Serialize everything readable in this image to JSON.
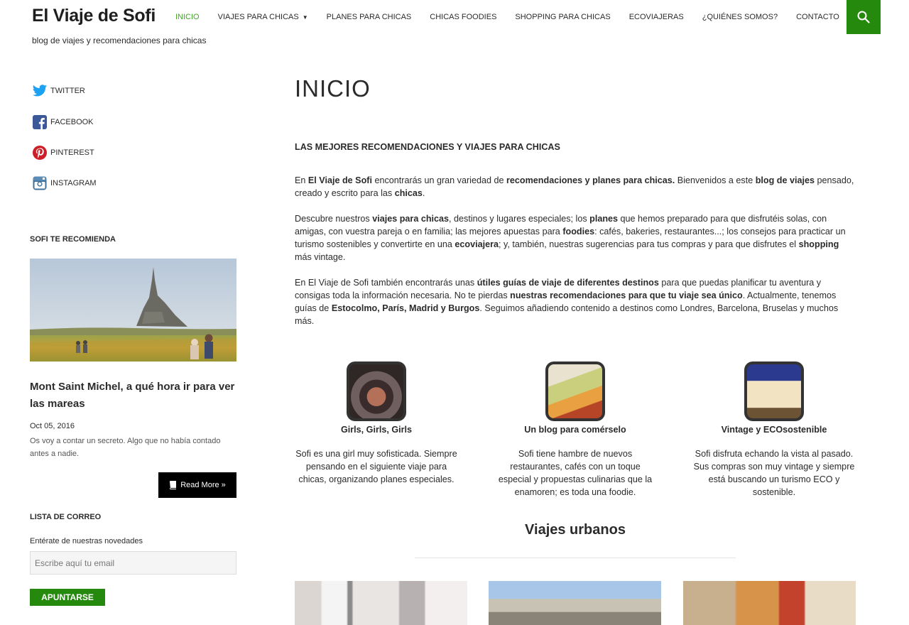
{
  "header": {
    "site_title": "El Viaje de Sofi",
    "tagline": "blog de viajes y recomendaciones para chicas",
    "nav": [
      {
        "label": "INICIO",
        "active": true
      },
      {
        "label": "VIAJES PARA CHICAS",
        "dropdown": true
      },
      {
        "label": "PLANES PARA CHICAS"
      },
      {
        "label": "CHICAS FOODIES"
      },
      {
        "label": "SHOPPING PARA CHICAS"
      },
      {
        "label": "ECOVIAJERAS"
      },
      {
        "label": "¿QUIÉNES SOMOS?"
      },
      {
        "label": "CONTACTO"
      }
    ],
    "search_icon": "search-icon",
    "accent_color": "#24890d",
    "active_color": "#41a62a"
  },
  "sidebar": {
    "social": [
      {
        "label": "TWITTER",
        "icon": "twitter-icon"
      },
      {
        "label": "FACEBOOK",
        "icon": "facebook-icon"
      },
      {
        "label": "PINTEREST",
        "icon": "pinterest-icon"
      },
      {
        "label": "INSTAGRAM",
        "icon": "instagram-icon"
      }
    ],
    "recommend_title": "SOFI TE RECOMIENDA",
    "featured": {
      "title": "Mont Saint Michel, a qué hora ir para ver las mareas",
      "date": "Oct 05, 2016",
      "excerpt": "Os voy a contar un secreto. Algo que no había contado antes a nadie.",
      "read_more": "Read More »"
    },
    "mailing_title": "LISTA DE CORREO",
    "mailing_label": "Entérate de nuestras novedades",
    "email_placeholder": "Escribe aquí tu email",
    "subscribe_label": "APUNTARSE"
  },
  "main": {
    "page_title": "INICIO",
    "heading": "LAS MEJORES RECOMENDACIONES Y VIAJES PARA CHICAS",
    "p1": {
      "a": "En ",
      "b": "El Viaje de Sofi",
      "c": " encontrarás un gran variedad de ",
      "d": "recomendaciones y planes para chicas.",
      "e": "  Bienvenidos a este ",
      "f": "blog de viajes",
      "g": " pensado, creado y escrito para  las ",
      "h": "chicas",
      "i": "."
    },
    "p2": {
      "a": "Descubre nuestros ",
      "b": "viajes para chicas",
      "c": ", destinos y lugares especiales; los ",
      "d": "planes",
      "e": " que hemos preparado para que disfrutéis solas, con amigas, con vuestra pareja o en familia; las mejores apuestas para ",
      "f": "foodies",
      "g": ": cafés, bakeries, restaurantes...; los consejos para practicar un turismo sostenibles y convertirte en una ",
      "h": "ecoviajera",
      "i": "; y, también, nuestras sugerencias para tus compras y para que  disfrutes el ",
      "j": "shopping",
      "k": " más vintage."
    },
    "p3": {
      "a": "En El Viaje de Sofi también encontrarás unas ",
      "b": "útiles guías de viaje de diferentes destinos",
      "c": " para que puedas planificar tu aventura y consigas toda la información necesaria. No te pierdas ",
      "d": "nuestras recomendaciones para que tu viaje sea único",
      "e": ". Actualmente, tenemos guías de ",
      "f": "Estocolmo, París, Madrid y Burgos",
      "g": ". Seguimos añadiendo contenido a destinos como Londres, Barcelona, Bruselas y muchos más."
    },
    "features": [
      {
        "title": "Girls, Girls, Girls",
        "desc": "Sofi es una girl muy sofisticada. Siempre pensando en el siguiente viaje para chicas, organizando planes especiales."
      },
      {
        "title": "Un blog para comérselo",
        "desc": "Sofi tiene hambre de nuevos restaurantes, cafés con un toque especial y propuestas culinarias que la enamoren; es toda una foodie."
      },
      {
        "title": "Vintage y ECOsostenible",
        "desc": "Sofi disfruta echando la vista al pasado. Sus compras son muy vintage y siempre está buscando un turismo ECO y sostenible."
      }
    ],
    "section_title": "Viajes urbanos"
  }
}
